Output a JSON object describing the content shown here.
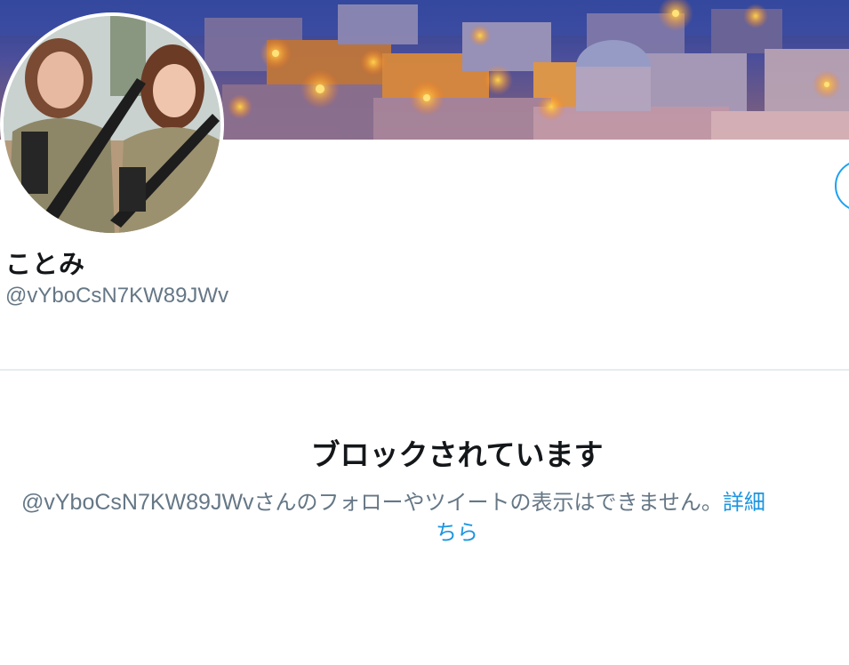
{
  "profile": {
    "display_name": "ことみ",
    "handle": "@vYboCsN7KW89JWv"
  },
  "blocked": {
    "title": "ブロックされています",
    "handle": "@vYboCsN7KW89JWv",
    "message": "さんのフォローやツイートの表示はできません。",
    "learn_more_part1": "詳細",
    "learn_more_part2": "ちら"
  },
  "colors": {
    "accent": "#1da1f2",
    "link": "#1b95e0",
    "text_primary": "#14171a",
    "text_secondary": "#657786",
    "divider": "#e6ecf0"
  },
  "icons": {
    "banner": "night-village-photo",
    "avatar": "profile-photo"
  }
}
